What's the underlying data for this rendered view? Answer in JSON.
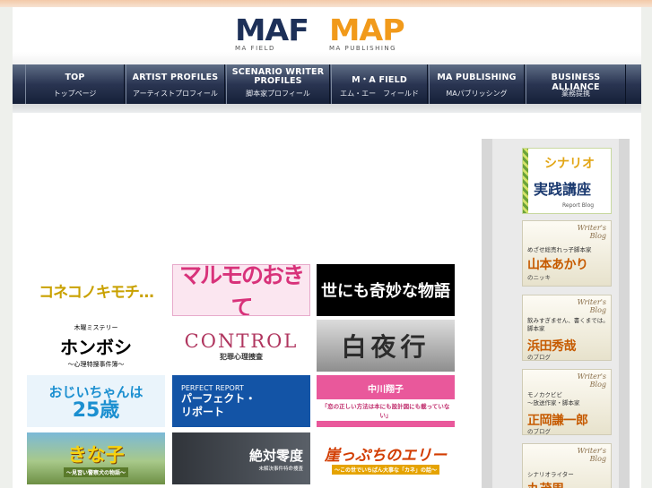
{
  "header": {
    "maf": {
      "mark": "MAF",
      "sub": "MA FIELD"
    },
    "map": {
      "mark": "MAP",
      "sub": "MA PUBLISHING"
    }
  },
  "nav": [
    {
      "en": "TOP",
      "jp": "トップページ"
    },
    {
      "en": "ARTIST PROFILES",
      "jp": "アーティストプロフィール"
    },
    {
      "en_line1": "SCENARIO WRITER",
      "en_line2": "PROFILES",
      "jp": "脚本家プロフィール"
    },
    {
      "en": "M・A FIELD",
      "jp": "エム・エー　フィールド"
    },
    {
      "en": "MA PUBLISHING",
      "jp": "MAパブリッシング"
    },
    {
      "en": "BUSINESS ALLIANCE",
      "jp": "業務提携"
    }
  ],
  "colors": {
    "nav": "#2a3552",
    "maf": "#1d3058",
    "map": "#f19a1b"
  },
  "works": {
    "koneko": "コネコノキモチ…",
    "marumo": "マルモのおきて",
    "yonimo": "世にも奇妙な物語",
    "honboshi": {
      "pre": "木曜ミステリー",
      "title": "ホンボシ",
      "sub": "〜心理特捜事件簿〜"
    },
    "control": {
      "title": "CONTROL",
      "sub": "犯罪心理捜査"
    },
    "byakuya": "白夜行",
    "ojii": {
      "line1": "おじいちゃんは",
      "line2": "25歳"
    },
    "perfect": {
      "small": "PERFECT REPORT",
      "line1": "パーフェクト・",
      "line2": "リポート"
    },
    "nakagawa": {
      "name": "中川翔子",
      "quote": "「恋の正しい方法は本にも設計図にも載っていない」"
    },
    "kinako": {
      "title": "きな子",
      "sub": "〜見習い警察犬の物語〜"
    },
    "zettai": {
      "title": "絶対零度",
      "sub": "未解決事件特命捜査"
    },
    "gakeppuchi": {
      "title": "崖っぷちのエリー",
      "sub": "〜この世でいちばん大事な「カネ」の話〜"
    }
  },
  "sidebar": {
    "scenario": {
      "line1": "シナリオ",
      "line2": "実践講座",
      "line3": "Report Blog"
    },
    "blogs": [
      {
        "tag1": "Writer's",
        "tag2": "Blog",
        "desc": "めざせ総売れっ子脚本家",
        "name": "山本あかり",
        "suffix": "のニッキ"
      },
      {
        "tag1": "Writer's",
        "tag2": "Blog",
        "desc": "飲みすぎません、書くまでは。",
        "desc2": "脚本家",
        "name": "浜田秀哉",
        "suffix": "のブログ"
      },
      {
        "tag1": "Writer's",
        "tag2": "Blog",
        "desc": "モノカクビビ",
        "desc2": "〜放送作家・脚本家",
        "name": "正岡謙一郎",
        "suffix": "のブログ"
      },
      {
        "tag1": "Writer's",
        "tag2": "Blog",
        "desc": "シナリオライター",
        "name": "丸茂周"
      }
    ]
  }
}
